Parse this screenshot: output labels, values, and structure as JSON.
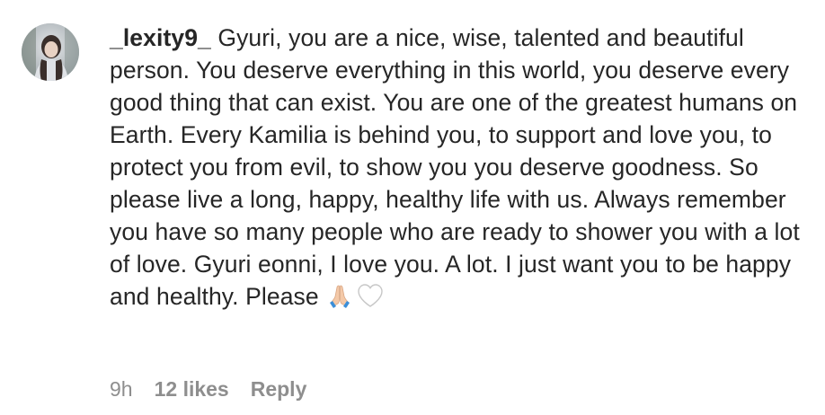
{
  "comment": {
    "username": "_lexity9_",
    "text": " Gyuri, you are a nice, wise, talented and beautiful person. You deserve everything in this world, you deserve every good thing that can exist. You are one of the greatest humans on Earth. Every Kamilia is behind you, to support and love you, to protect you from evil, to show you you deserve goodness. So please live a long, happy, healthy life with us. Always remember you have so many people who are ready to shower you with a lot of love. Gyuri eonni, I love you. A lot. I just want you to be happy and healthy. Please",
    "emojis": [
      "folded-hands-icon",
      "white-heart-icon"
    ],
    "time": "9h",
    "likes": "12 likes",
    "reply_label": "Reply"
  },
  "colors": {
    "text_primary": "#262626",
    "text_secondary": "#8e8e8e",
    "background": "#ffffff"
  }
}
